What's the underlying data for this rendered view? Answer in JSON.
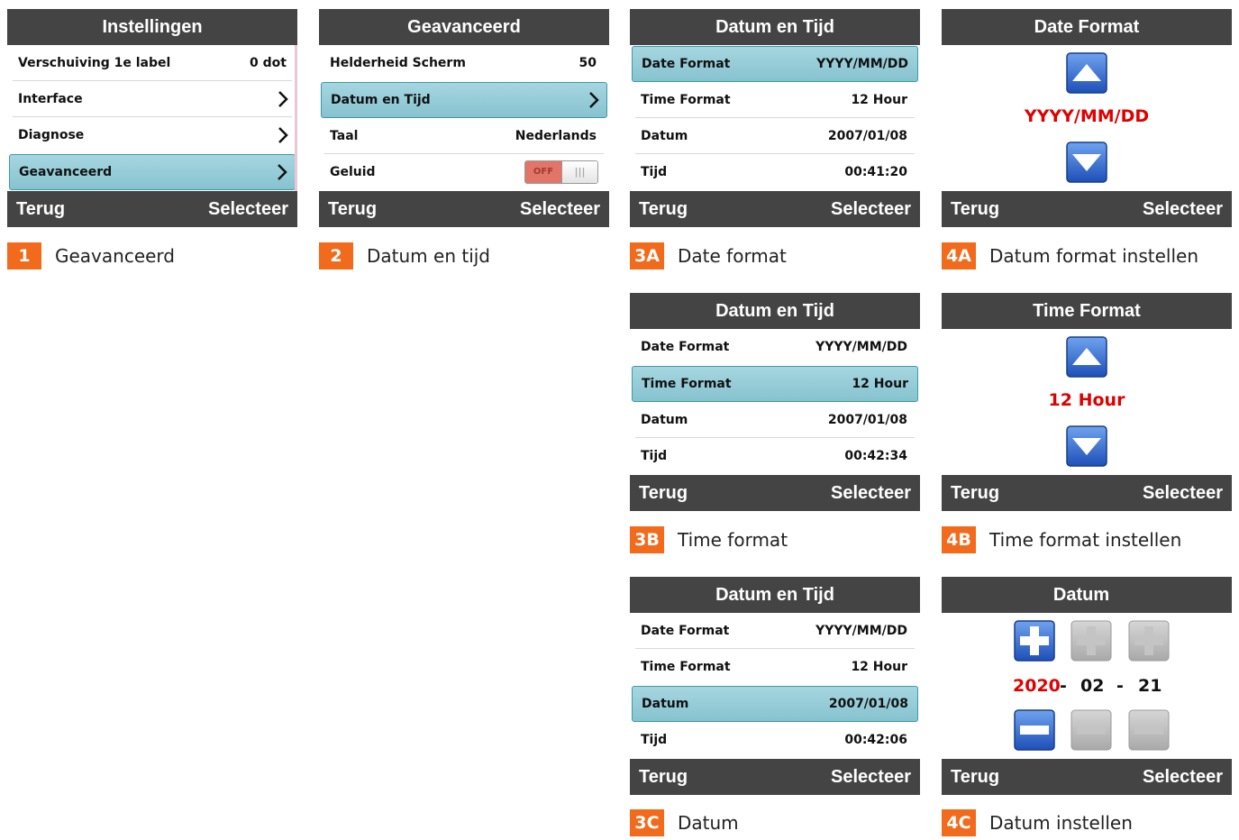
{
  "footer": {
    "back_label": "Terug",
    "select_label": "Selecteer"
  },
  "screen1": {
    "title": "Instellingen",
    "rows": [
      {
        "label": "Verschuiving 1e label",
        "value": "0 dot"
      },
      {
        "label": "Interface"
      },
      {
        "label": "Diagnose"
      },
      {
        "label": "Geavanceerd"
      }
    ],
    "caption": {
      "num": "1",
      "text": "Geavanceerd"
    }
  },
  "screen2": {
    "title": "Geavanceerd",
    "rows": [
      {
        "label": "Helderheid Scherm",
        "value": "50"
      },
      {
        "label": "Datum en Tijd"
      },
      {
        "label": "Taal",
        "value": "Nederlands"
      },
      {
        "label": "Geluid",
        "toggle": "OFF"
      }
    ],
    "caption": {
      "num": "2",
      "text": "Datum en tijd"
    }
  },
  "screen3a": {
    "title": "Datum en Tijd",
    "rows": [
      {
        "label": "Date Format",
        "value": "YYYY/MM/DD"
      },
      {
        "label": "Time Format",
        "value": "12 Hour"
      },
      {
        "label": "Datum",
        "value": "2007/01/08"
      },
      {
        "label": "Tijd",
        "value": "00:41:20"
      }
    ],
    "caption": {
      "num": "3A",
      "text": "Date format"
    }
  },
  "screen3b": {
    "title": "Datum en Tijd",
    "rows": [
      {
        "label": "Date Format",
        "value": "YYYY/MM/DD"
      },
      {
        "label": "Time Format",
        "value": "12 Hour"
      },
      {
        "label": "Datum",
        "value": "2007/01/08"
      },
      {
        "label": "Tijd",
        "value": "00:42:34"
      }
    ],
    "caption": {
      "num": "3B",
      "text": "Time format"
    }
  },
  "screen3c": {
    "title": "Datum en Tijd",
    "rows": [
      {
        "label": "Date Format",
        "value": "YYYY/MM/DD"
      },
      {
        "label": "Time Format",
        "value": "12 Hour"
      },
      {
        "label": "Datum",
        "value": "2007/01/08"
      },
      {
        "label": "Tijd",
        "value": "00:42:06"
      }
    ],
    "caption": {
      "num": "3C",
      "text": "Datum"
    }
  },
  "screen4a": {
    "title": "Date Format",
    "value": "YYYY/MM/DD",
    "caption": {
      "num": "4A",
      "text": "Datum format instellen"
    }
  },
  "screen4b": {
    "title": "Time Format",
    "value": "12 Hour",
    "caption": {
      "num": "4B",
      "text": "Time format instellen"
    }
  },
  "screen4c": {
    "title": "Datum",
    "year": "2020",
    "sep": "-",
    "month": "02",
    "day": "21",
    "caption": {
      "num": "4C",
      "text": "Datum instellen"
    }
  },
  "colors": {
    "header": "#444444",
    "selected": "#94cdd8",
    "badge": "#f26a1b",
    "highlight": "#e00000"
  }
}
